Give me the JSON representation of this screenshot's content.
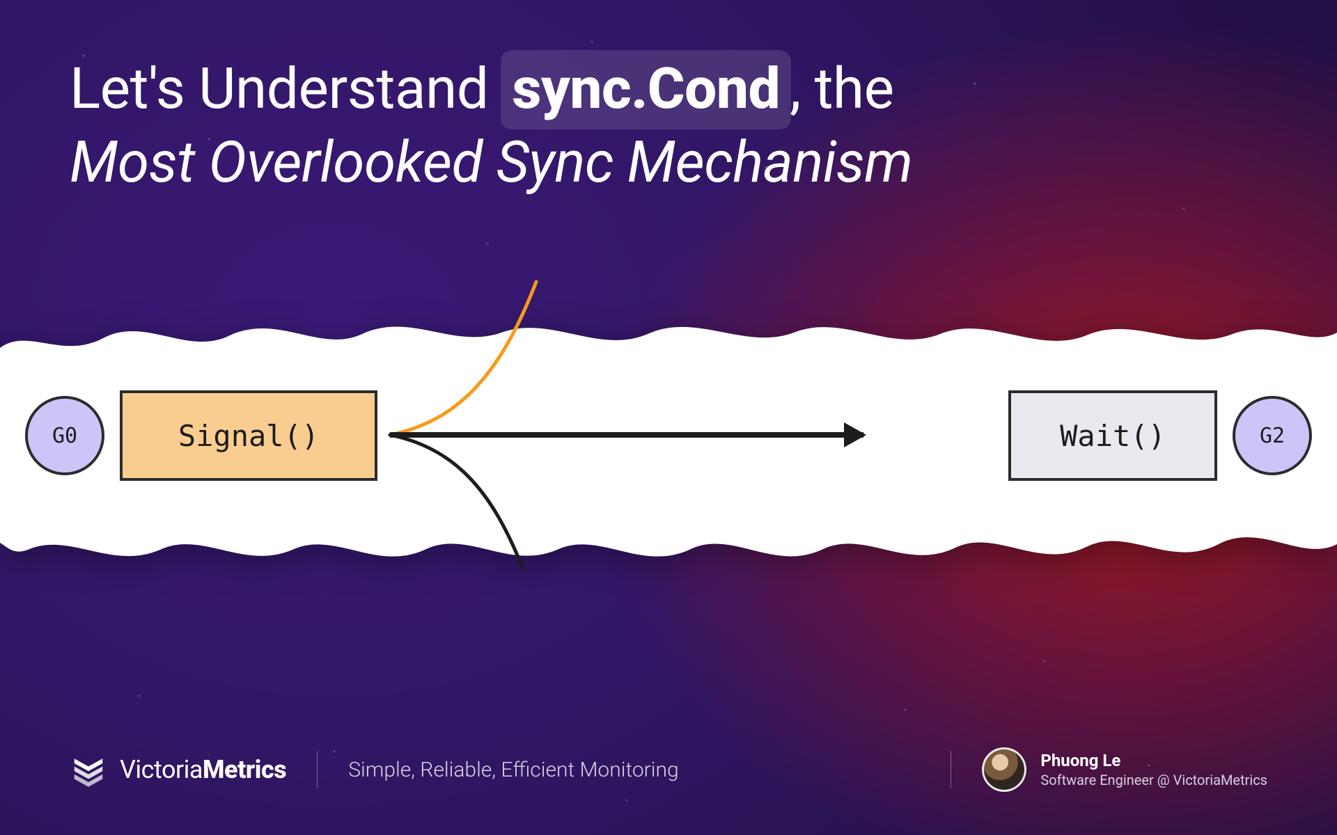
{
  "title": {
    "line1_prefix": "Let's Understand ",
    "highlight": "sync.Cond",
    "line1_suffix": ", the",
    "line2": "Most Overlooked Sync Mechanism"
  },
  "diagram": {
    "left_node": "G0",
    "signal_label": "Signal()",
    "wait_label": "Wait()",
    "right_node": "G2"
  },
  "footer": {
    "brand_regular": "Victoria",
    "brand_bold": "Metrics",
    "tagline": "Simple, Reliable, Efficient Monitoring",
    "author_name": "Phuong Le",
    "author_role": "Software Engineer @ VictoriaMetrics"
  },
  "colors": {
    "signal_bg": "#f9cd90",
    "wait_bg": "#e9e9ef",
    "node_bg": "#cfc4f8",
    "accent_orange": "#f79a1c"
  }
}
